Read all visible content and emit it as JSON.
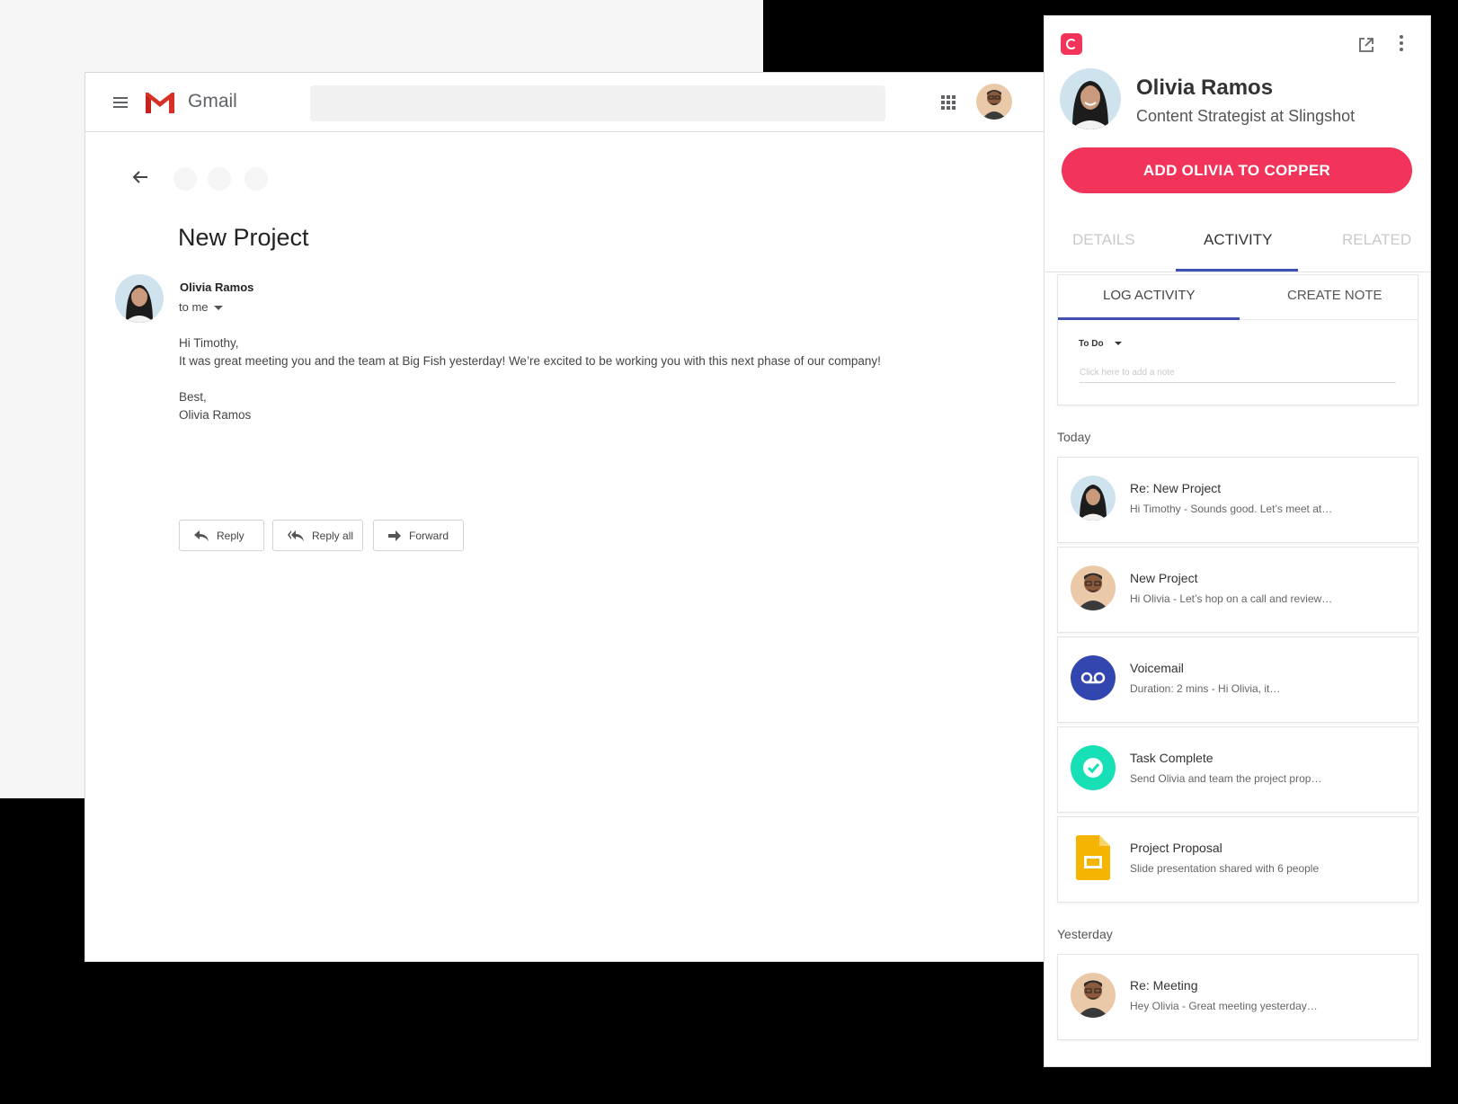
{
  "gmail": {
    "brand": "Gmail",
    "email": {
      "subject": "New Project",
      "sender_name": "Olivia Ramos",
      "recipient": "to me",
      "body": {
        "greeting": "Hi Timothy,",
        "line1": "It was great meeting you and the team at Big Fish yesterday! We’re excited to be working you with this next phase of our company!",
        "signoff": "Best,",
        "signature": "Olivia Ramos"
      }
    },
    "actions": {
      "reply": "Reply",
      "reply_all": "Reply all",
      "forward": "Forward"
    }
  },
  "copper": {
    "contact": {
      "name": "Olivia Ramos",
      "title": "Content Strategist at Slingshot"
    },
    "add_button": "ADD OLIVIA TO COPPER",
    "tabs": [
      "DETAILS",
      "ACTIVITY",
      "RELATED"
    ],
    "active_tab": "ACTIVITY",
    "log_tabs": [
      "LOG ACTIVITY",
      "CREATE NOTE"
    ],
    "activity_type": "To Do",
    "note_placeholder": "Click here to add a note",
    "sections": {
      "today": "Today",
      "yesterday": "Yesterday"
    },
    "activities_today": [
      {
        "title": "Re: New Project",
        "subtitle": "Hi Timothy -  Sounds good. Let’s meet at…",
        "icon": "olivia-avatar"
      },
      {
        "title": "New Project",
        "subtitle": "Hi Olivia - Let’s hop on a call and review…",
        "icon": "timothy-avatar"
      },
      {
        "title": "Voicemail",
        "subtitle": "Duration: 2 mins -  Hi Olivia, it…",
        "icon": "voicemail-icon"
      },
      {
        "title": "Task Complete",
        "subtitle": "Send Olivia and team the project prop…",
        "icon": "check-icon"
      },
      {
        "title": "Project Proposal",
        "subtitle": "Slide presentation shared with 6 people",
        "icon": "slides-icon"
      }
    ],
    "activities_yesterday": [
      {
        "title": "Re: Meeting",
        "subtitle": "Hey Olivia - Great meeting yesterday…",
        "icon": "timothy-avatar"
      }
    ],
    "colors": {
      "brand": "#f2345b",
      "accent": "#3f51b5",
      "voicemail": "#3346b0",
      "task": "#17e0b6",
      "slides": "#f4b400"
    }
  }
}
